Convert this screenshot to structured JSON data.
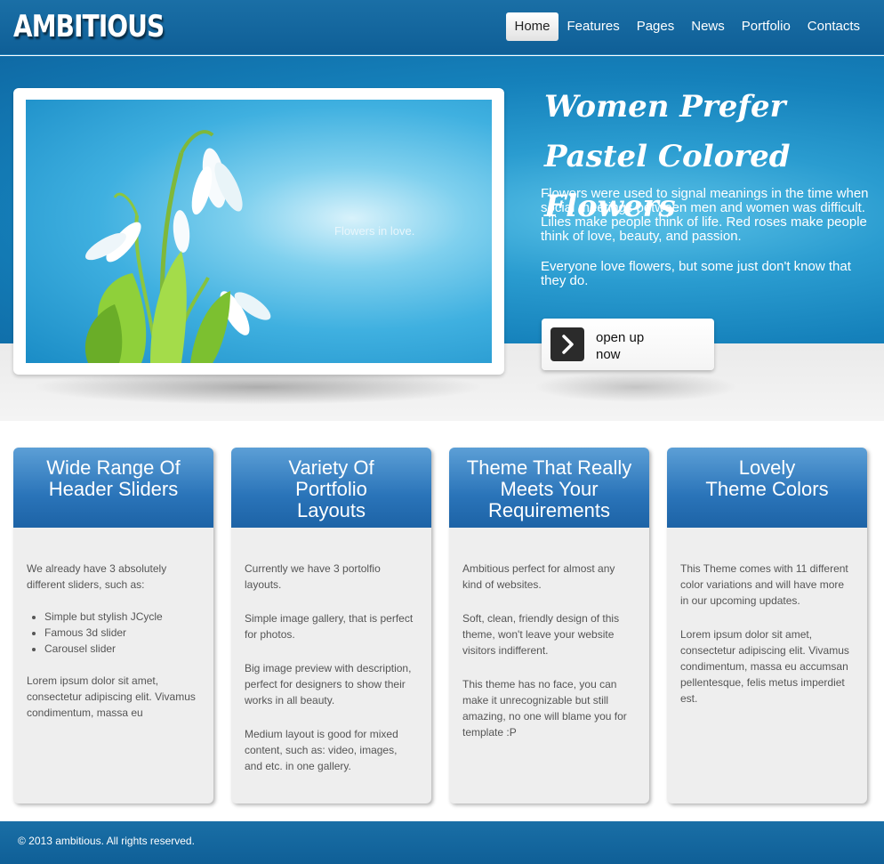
{
  "header": {
    "logo": "AMBITIOUS",
    "nav": [
      {
        "label": "Home"
      },
      {
        "label": "Features"
      },
      {
        "label": "Pages"
      },
      {
        "label": "News"
      },
      {
        "label": "Portfolio"
      },
      {
        "label": "Contacts"
      }
    ]
  },
  "hero": {
    "image_caption": "Flowers in love.",
    "title_line1": "Women Prefer",
    "title_line2": "Pastel Colored Flowers",
    "paragraph1": "Flowers were used to signal meanings in the time when social meetings between men and women was difficult. Lilies make people think of life. Red roses make people think of love, beauty, and passion.",
    "paragraph2": "Everyone love flowers, but some just don't know that they do.",
    "button_label": "open up now"
  },
  "boxes": [
    {
      "title_lines": [
        "Wide Range Of",
        "Header Sliders"
      ],
      "intro": "We already have 3 absolutely different sliders, such as:",
      "list": [
        "Simple but stylish JCycle",
        "Famous 3d slider",
        "Carousel slider"
      ],
      "outro": "Lorem ipsum dolor sit amet, consectetur adipiscing elit. Vivamus condimentum, massa eu"
    },
    {
      "title_lines": [
        "Variety Of",
        "Portfolio",
        "Layouts"
      ],
      "paragraphs": [
        "Currently we have 3 portolfio layouts.",
        "Simple image gallery, that is perfect for photos.",
        "Big image preview with description, perfect for designers to show their works in all beauty.",
        "Medium layout is good for mixed content, such as: video, images, and etc. in one gallery."
      ]
    },
    {
      "title_lines": [
        "Theme That Really",
        "Meets Your",
        "Requirements"
      ],
      "paragraphs": [
        "Ambitious perfect for almost any kind of websites.",
        "Soft, clean, friendly design of this theme, won't leave your website visitors indifferent.",
        "This theme has no face, you can make it unrecognizable but still amazing, no one will blame you for template :P"
      ]
    },
    {
      "title_lines": [
        "Lovely",
        "Theme Colors"
      ],
      "paragraphs": [
        "This Theme comes with 11 different color variations and will have more in our upcoming updates.",
        "Lorem ipsum dolor sit amet, consectetur adipiscing elit. Vivamus condimentum, massa eu accumsan pellentesque, felis metus imperdiet est."
      ]
    }
  ],
  "footer": {
    "copyright": "© 2013 ambitious. All rights reserved."
  }
}
